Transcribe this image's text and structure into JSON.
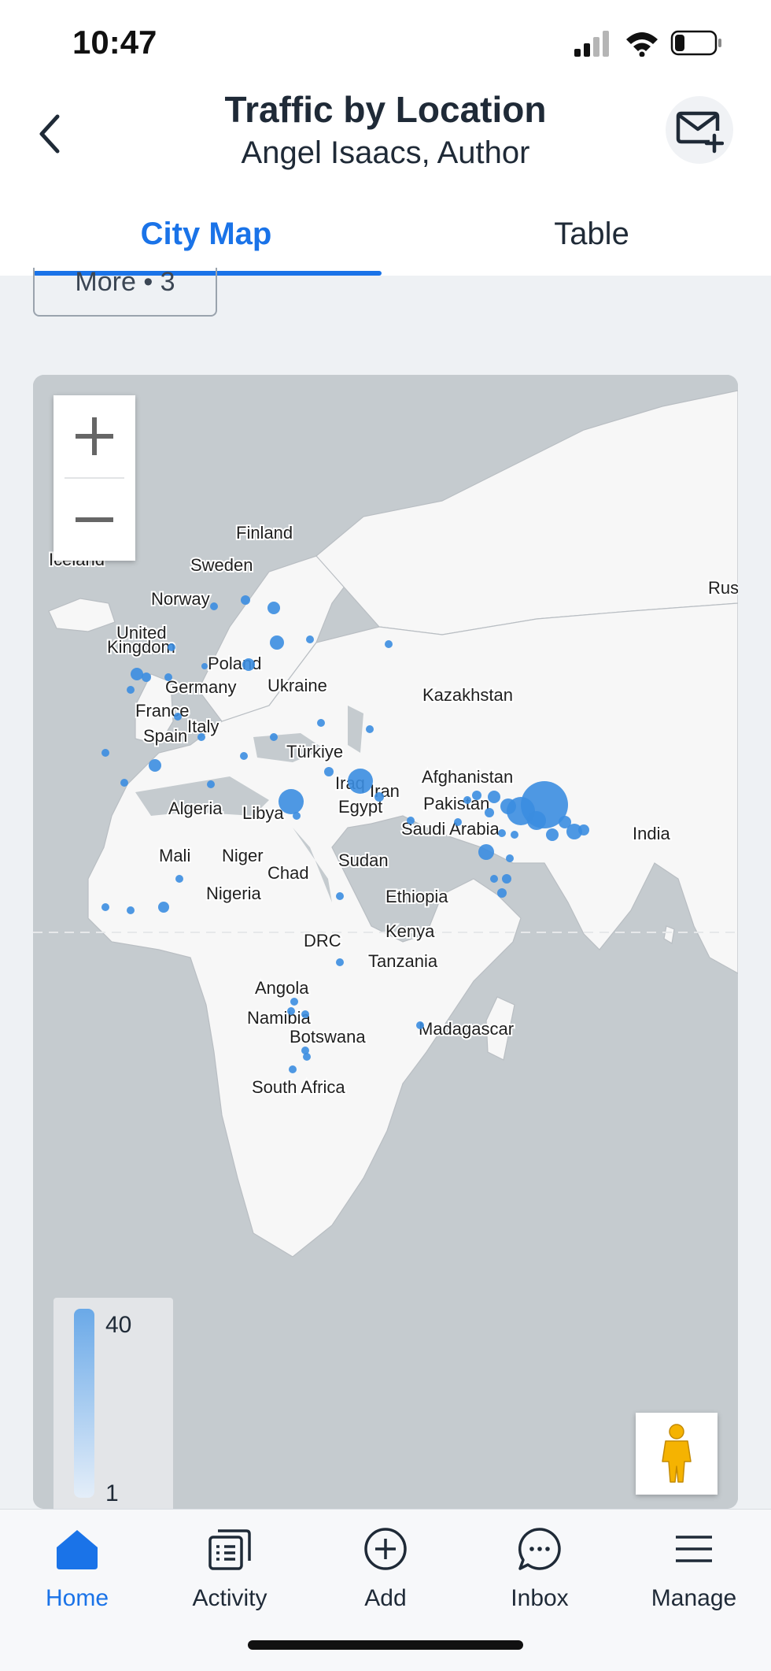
{
  "status_bar": {
    "time": "10:47"
  },
  "header": {
    "title": "Traffic by Location",
    "subtitle": "Angel Isaacs, Author"
  },
  "tabs": [
    {
      "label": "City Map",
      "active": true
    },
    {
      "label": "Table",
      "active": false
    }
  ],
  "filter_chip": {
    "label": "More • 3"
  },
  "map": {
    "labels": {
      "iceland": "Iceland",
      "finland": "Finland",
      "sweden": "Sweden",
      "norway": "Norway",
      "rus": "Rus",
      "uk_line1": "United",
      "uk_line2": "Kingdom",
      "poland": "Poland",
      "germany": "Germany",
      "ukraine": "Ukraine",
      "kazakhstan": "Kazakhstan",
      "france": "France",
      "italy": "Italy",
      "spain": "Spain",
      "turkiye": "Türkiye",
      "afghanistan": "Afghanistan",
      "iraq": "Iraq",
      "iran": "Iran",
      "pakistan": "Pakistan",
      "algeria": "Algeria",
      "libya": "Libya",
      "egypt": "Egypt",
      "saudi_arabia": "Saudi Arabia",
      "india": "India",
      "mali": "Mali",
      "niger": "Niger",
      "sudan": "Sudan",
      "chad": "Chad",
      "nigeria": "Nigeria",
      "ethiopia": "Ethiopia",
      "kenya": "Kenya",
      "drc": "DRC",
      "tanzania": "Tanzania",
      "angola": "Angola",
      "namibia": "Namibia",
      "botswana": "Botswana",
      "madagascar": "Madagascar",
      "south_africa": "South Africa"
    },
    "legend": {
      "max": "40",
      "min": "1",
      "color": "#6aa9e8"
    },
    "marker_color": "#3b8de0"
  },
  "nav": [
    {
      "label": "Home",
      "icon": "home-icon",
      "active": true
    },
    {
      "label": "Activity",
      "icon": "activity-icon",
      "active": false
    },
    {
      "label": "Add",
      "icon": "add-circle-icon",
      "active": false
    },
    {
      "label": "Inbox",
      "icon": "inbox-chat-icon",
      "active": false
    },
    {
      "label": "Manage",
      "icon": "menu-icon",
      "active": false
    }
  ],
  "colors": {
    "accent": "#1a73e8",
    "land": "#f7f7f7",
    "water": "#c5cbcf"
  }
}
